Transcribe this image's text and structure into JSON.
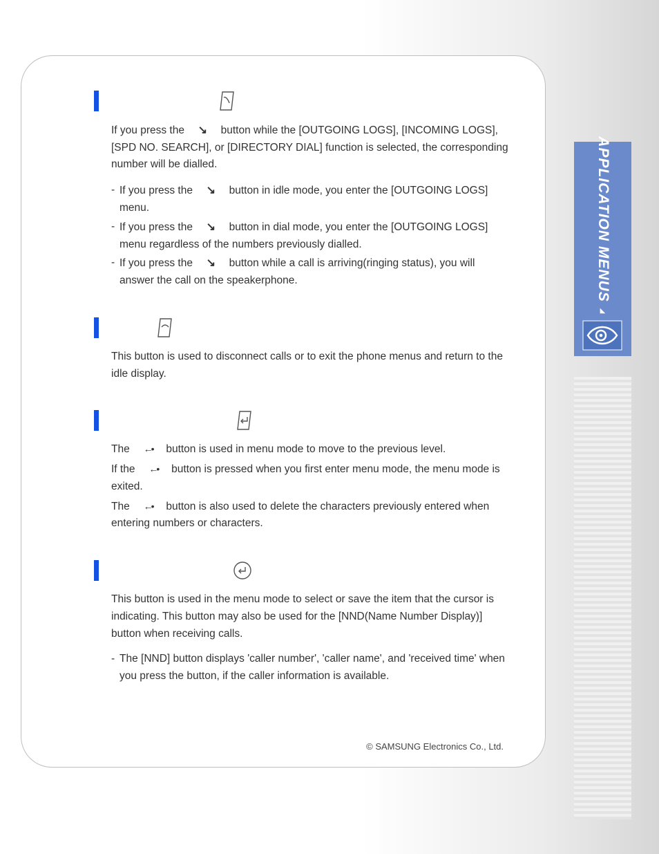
{
  "sidebar": {
    "title": "APPLICATION MENUS"
  },
  "sections": {
    "send": {
      "p1": "If you press the ",
      "p2": " button while the [OUTGOING LOGS], [INCOMING LOGS], [SPD NO. SEARCH], or [DIRECTORY DIAL] function is selected, the corresponding number will be dialled.",
      "l1a": "If you press the ",
      "l1b": " button in idle mode, you enter the [OUTGOING LOGS] menu.",
      "l2a": "If you press the ",
      "l2b": " button in dial mode, you enter the [OUTGOING LOGS] menu regardless of the numbers previously dialled.",
      "l3a": "If you press the ",
      "l3b": " button while a call is arriving(ringing status), you will answer the call on the speakerphone."
    },
    "end": {
      "p": "This button is used to disconnect calls or to exit the phone menus and return to the idle display."
    },
    "cancel": {
      "p1a": "The ",
      "p1b": " button is used in menu mode to move to the previous level.",
      "p2a": "If the ",
      "p2b": " button is pressed when you first enter menu mode, the menu mode is exited.",
      "p3a": "The ",
      "p3b": " button is also used to delete the characters previously entered when entering numbers or characters."
    },
    "enter": {
      "p": "This button is used in the menu mode to select or save the item that the cursor is indicating. This button may also be used for the [NND(Name Number Display)] button when receiving calls.",
      "l1": "The [NND] button displays 'caller number', 'caller name', and 'received time' when you press the button, if the caller information is available."
    }
  },
  "footer": "© SAMSUNG Electronics Co., Ltd."
}
